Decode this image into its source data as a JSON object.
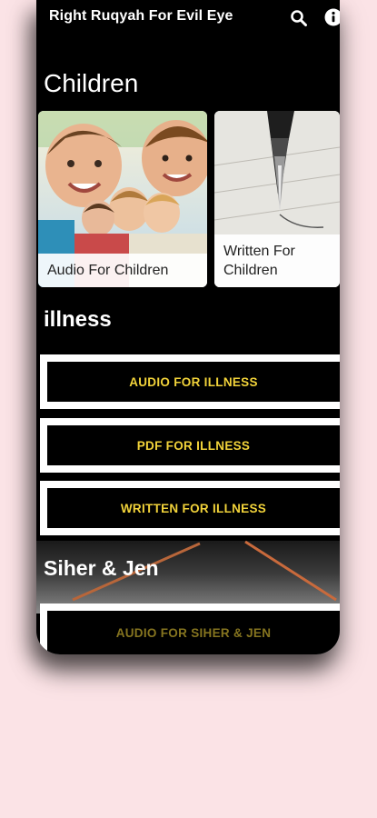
{
  "app": {
    "title": "Right Ruqyah For Evil Eye",
    "accent_color": "#f2d33a",
    "background_color": "#fbe3e6"
  },
  "toolbar": {
    "search_icon": "search-icon",
    "info_icon": "info-icon"
  },
  "sections": {
    "children": {
      "title": "Children",
      "cards": [
        {
          "label": "Audio For Children"
        },
        {
          "label": "Written For Children"
        }
      ]
    },
    "illness": {
      "title": "illness",
      "buttons": [
        {
          "label": "AUDIO FOR ILLNESS"
        },
        {
          "label": "PDF FOR ILLNESS"
        },
        {
          "label": "WRITTEN FOR ILLNESS"
        }
      ]
    },
    "siher": {
      "title": "Siher & Jen",
      "buttons": [
        {
          "label": "AUDIO FOR SIHER & JEN"
        }
      ]
    }
  }
}
